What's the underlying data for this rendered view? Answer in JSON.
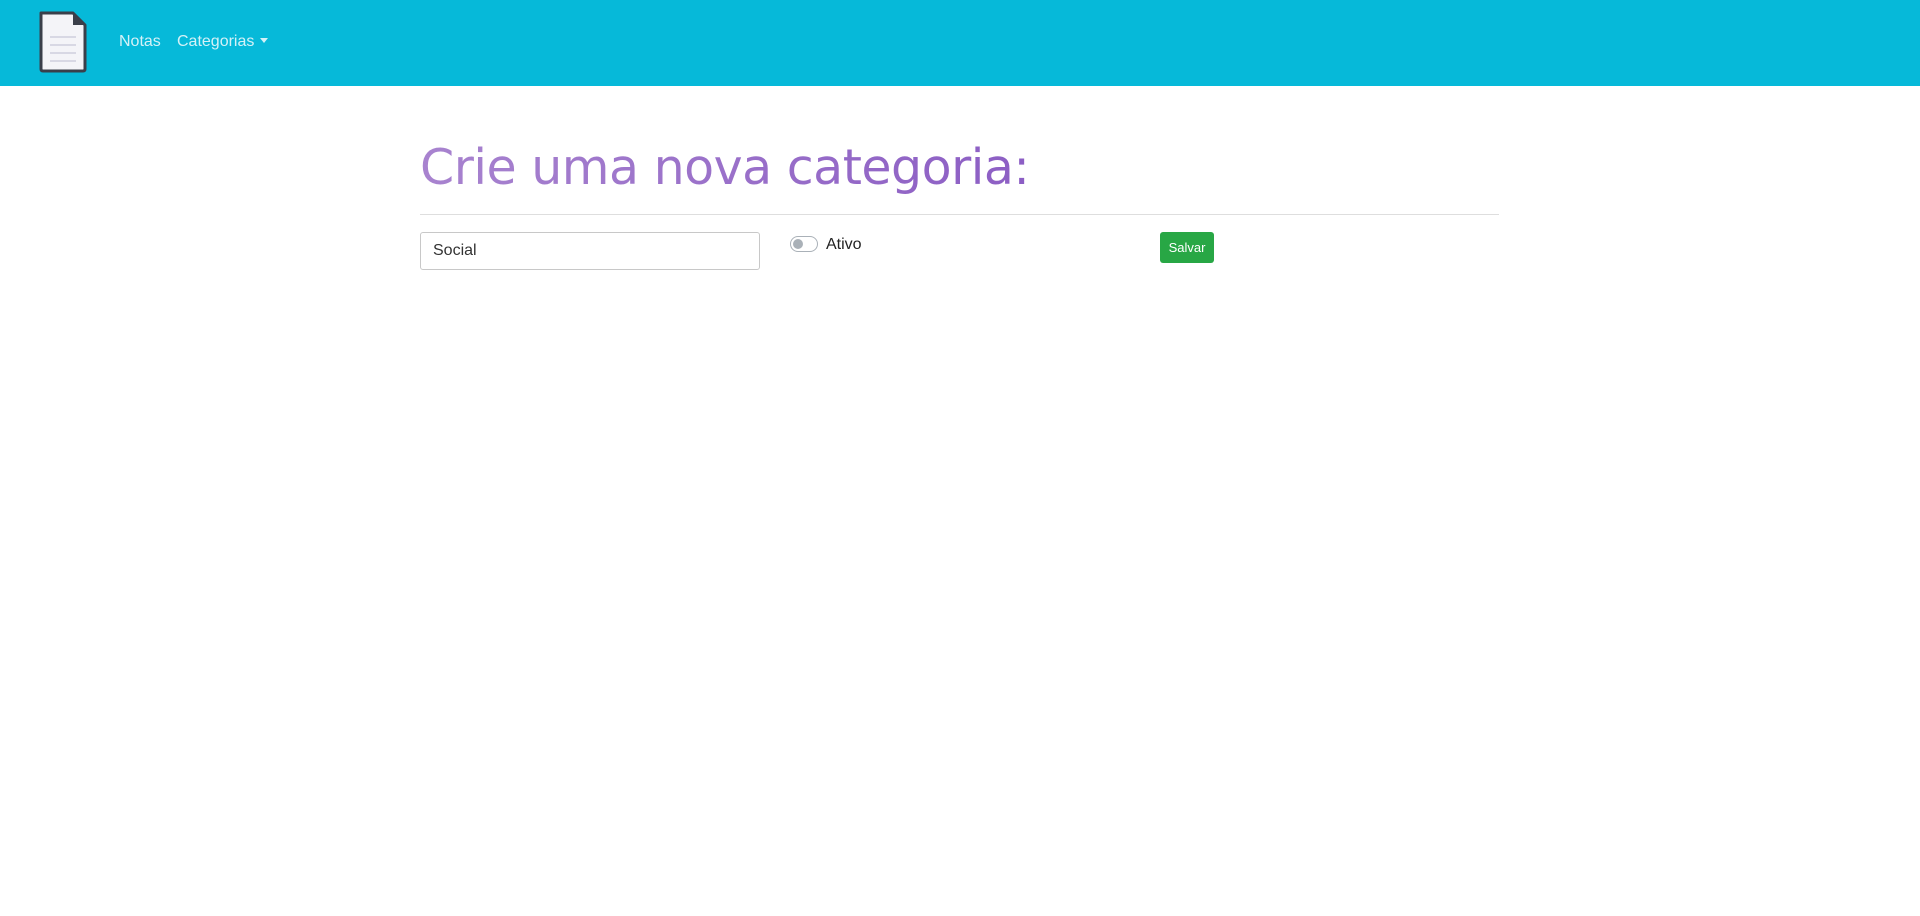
{
  "navbar": {
    "logo_icon": "document-icon",
    "links": [
      {
        "label": "Notas"
      },
      {
        "label": "Categorias",
        "has_dropdown": true
      }
    ],
    "background": "#06b9d9"
  },
  "main": {
    "title": "Crie uma nova categoria:",
    "form": {
      "name_value": "Social",
      "active_label": "Ativo",
      "active_checked": false,
      "save_label": "Salvar"
    }
  },
  "colors": {
    "title_gradient_start": "#a883cf",
    "title_gradient_end": "#8c5ec4",
    "save_button": "#28a745"
  }
}
